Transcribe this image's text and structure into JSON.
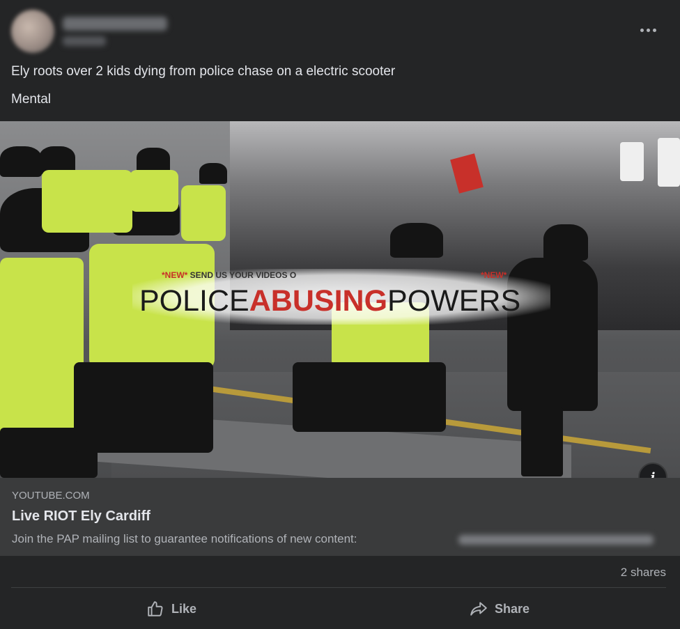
{
  "post": {
    "text_line1": "Ely roots over 2 kids dying from police chase on a electric scooter",
    "text_line2": "Mental",
    "more_icon": "more-horizontal-icon"
  },
  "media": {
    "overlay_new_left": "*NEW*",
    "overlay_send": " SEND US YOUR VIDEOS O",
    "overlay_new_right": "*NEW*",
    "overlay_word1": "POLICE",
    "overlay_word2": "ABUSING",
    "overlay_word3": "POWERS",
    "info_icon": "info-icon",
    "info_label": "i"
  },
  "link_card": {
    "domain": "YOUTUBE.COM",
    "title": "Live RIOT Ely Cardiff",
    "description": "Join the PAP mailing list to guarantee notifications of new content:"
  },
  "footer": {
    "shares": "2 shares",
    "like_label": "Like",
    "share_label": "Share"
  },
  "colors": {
    "background": "#242526",
    "card": "#3a3b3c",
    "text": "#e4e6eb",
    "muted": "#b0b3b8",
    "accent_red": "#c8302a"
  }
}
